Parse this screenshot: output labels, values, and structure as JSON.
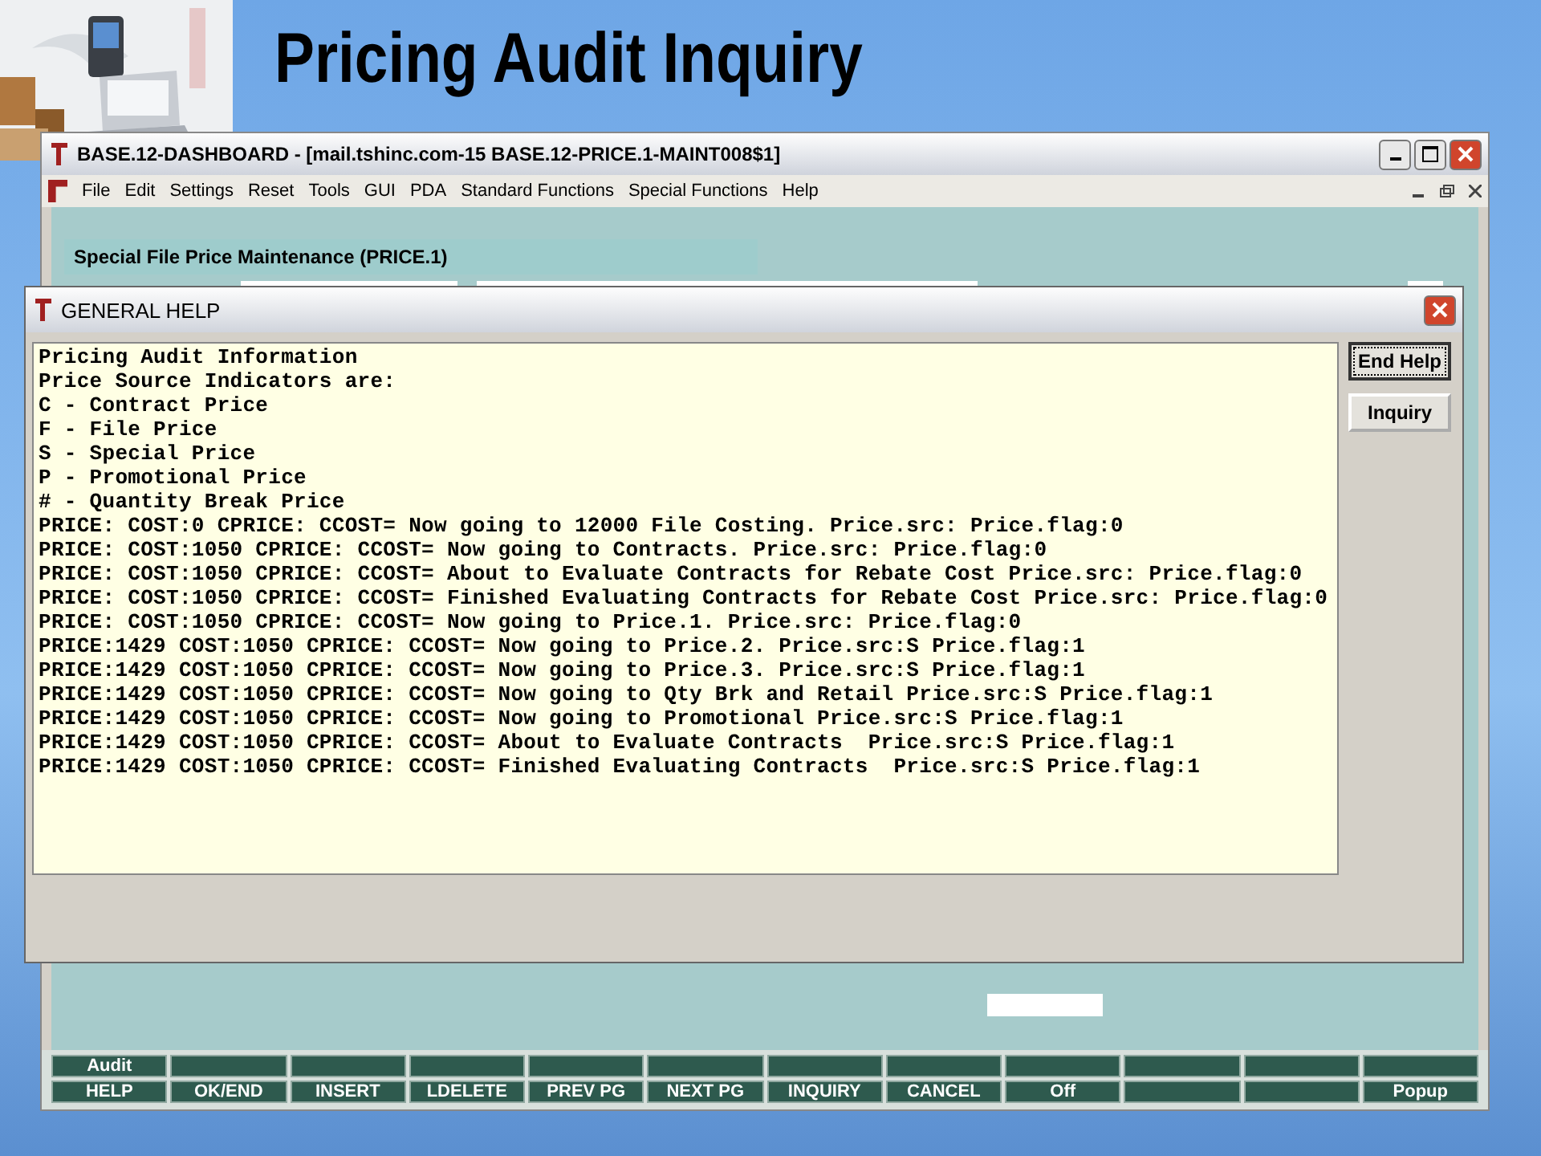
{
  "slide": {
    "title": "Pricing Audit Inquiry"
  },
  "main_window": {
    "title": "BASE.12-DASHBOARD - [mail.tshinc.com-15 BASE.12-PRICE.1-MAINT008$1]",
    "menu": [
      "File",
      "Edit",
      "Settings",
      "Reset",
      "Tools",
      "GUI",
      "PDA",
      "Standard Functions",
      "Special Functions",
      "Help"
    ],
    "screen_title": "Special File Price Maintenance (PRICE.1)",
    "function_keys_top": [
      {
        "kind": "key",
        "label": "Audit"
      },
      {
        "kind": "blank"
      },
      {
        "kind": "blank"
      },
      {
        "kind": "blank"
      },
      {
        "kind": "blank"
      },
      {
        "kind": "blank"
      },
      {
        "kind": "blank"
      },
      {
        "kind": "blank"
      },
      {
        "kind": "blank"
      },
      {
        "kind": "blank"
      },
      {
        "kind": "blank"
      },
      {
        "kind": "blank"
      }
    ],
    "function_keys": [
      {
        "kind": "key",
        "label": "HELP"
      },
      {
        "kind": "key",
        "label": "OK/END"
      },
      {
        "kind": "key",
        "label": "INSERT"
      },
      {
        "kind": "key",
        "label": "LDELETE"
      },
      {
        "kind": "key",
        "label": "PREV PG"
      },
      {
        "kind": "key",
        "label": "NEXT PG"
      },
      {
        "kind": "key",
        "label": "INQUIRY"
      },
      {
        "kind": "key",
        "label": "CANCEL"
      },
      {
        "kind": "key",
        "label": "Off"
      },
      {
        "kind": "blank"
      },
      {
        "kind": "blank"
      },
      {
        "kind": "key",
        "label": "Popup"
      }
    ]
  },
  "help_dialog": {
    "title": "GENERAL HELP",
    "lines": [
      "Pricing Audit Information",
      "Price Source Indicators are:",
      "C - Contract Price",
      "F - File Price",
      "S - Special Price",
      "P - Promotional Price",
      "# - Quantity Break Price",
      "PRICE: COST:0 CPRICE: CCOST= Now going to 12000 File Costing. Price.src: Price.flag:0",
      "PRICE: COST:1050 CPRICE: CCOST= Now going to Contracts. Price.src: Price.flag:0",
      "PRICE: COST:1050 CPRICE: CCOST= About to Evaluate Contracts for Rebate Cost Price.src: Price.flag:0",
      "PRICE: COST:1050 CPRICE: CCOST= Finished Evaluating Contracts for Rebate Cost Price.src: Price.flag:0",
      "PRICE: COST:1050 CPRICE: CCOST= Now going to Price.1. Price.src: Price.flag:0",
      "PRICE:1429 COST:1050 CPRICE: CCOST= Now going to Price.2. Price.src:S Price.flag:1",
      "PRICE:1429 COST:1050 CPRICE: CCOST= Now going to Price.3. Price.src:S Price.flag:1",
      "PRICE:1429 COST:1050 CPRICE: CCOST= Now going to Qty Brk and Retail Price.src:S Price.flag:1",
      "PRICE:1429 COST:1050 CPRICE: CCOST= Now going to Promotional Price.src:S Price.flag:1",
      "PRICE:1429 COST:1050 CPRICE: CCOST= About to Evaluate Contracts  Price.src:S Price.flag:1",
      "PRICE:1429 COST:1050 CPRICE: CCOST= Finished Evaluating Contracts  Price.src:S Price.flag:1"
    ],
    "buttons": [
      {
        "label": "End Help",
        "selected": true
      },
      {
        "label": "Inquiry",
        "selected": false
      }
    ]
  }
}
